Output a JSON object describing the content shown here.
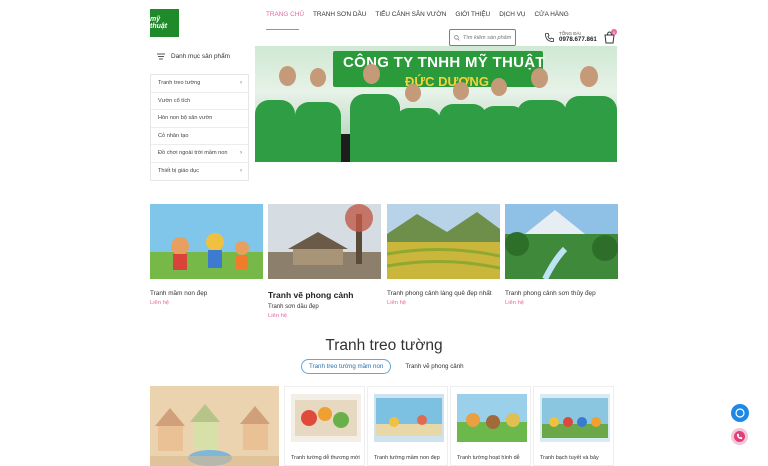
{
  "header": {
    "logo_text": "mỹ thuật",
    "nav": [
      "TRANG CHỦ",
      "TRANH SƠN DẦU",
      "TIỂU CẢNH SÂN VƯỜN",
      "GIỚI THIỆU",
      "DỊCH VỤ",
      "CỬA HÀNG"
    ],
    "search_placeholder": "Tìm kiếm sản phẩm",
    "hotline_label": "TỔNG ĐÀI",
    "hotline_number": "0978.677.861",
    "cart_count": "0"
  },
  "sidebar": {
    "title": "Danh mục sản phẩm",
    "items": [
      {
        "label": "Tranh treo tường",
        "chevron": true
      },
      {
        "label": "Vườn cổ tích",
        "chevron": false
      },
      {
        "label": "Hòn non bộ sân vườn",
        "chevron": false
      },
      {
        "label": "Cỏ nhân tạo",
        "chevron": false
      },
      {
        "label": "Đồ chơi ngoài trời mầm non",
        "chevron": true
      },
      {
        "label": "Thiết bị giáo dục",
        "chevron": true
      }
    ]
  },
  "banner": {
    "title": "CÔNG TY TNHH MỸ THUẬT",
    "subtitle": "ĐỨC DƯƠNG"
  },
  "cards": [
    {
      "title": "Tranh mầm non đẹp",
      "subtitle": "",
      "link": "Liên hệ"
    },
    {
      "title": "Tranh vẽ phong cảnh",
      "subtitle": "Tranh sơn dầu đẹp",
      "link": "Liên hệ"
    },
    {
      "title": "Tranh phong cảnh làng quê đẹp nhất",
      "subtitle": "",
      "link": "Liên hệ"
    },
    {
      "title": "Tranh phong cảnh sơn thủy đẹp",
      "subtitle": "",
      "link": "Liên hệ"
    }
  ],
  "section": {
    "title": "Tranh treo tường",
    "tabs": [
      "Tranh treo tường mầm non",
      "Tranh vẽ phong cảnh"
    ]
  },
  "products": [
    {
      "title": "Tranh tường dễ thương mới"
    },
    {
      "title": "Tranh tường mầm non đẹp"
    },
    {
      "title": "Tranh tường hoạt hình dễ"
    },
    {
      "title": "Tranh bạch tuyết và bảy"
    }
  ],
  "colors": {
    "accent": "#e56aa0",
    "brand_green": "#2f9d44",
    "tab_blue": "#5fa8d8"
  }
}
